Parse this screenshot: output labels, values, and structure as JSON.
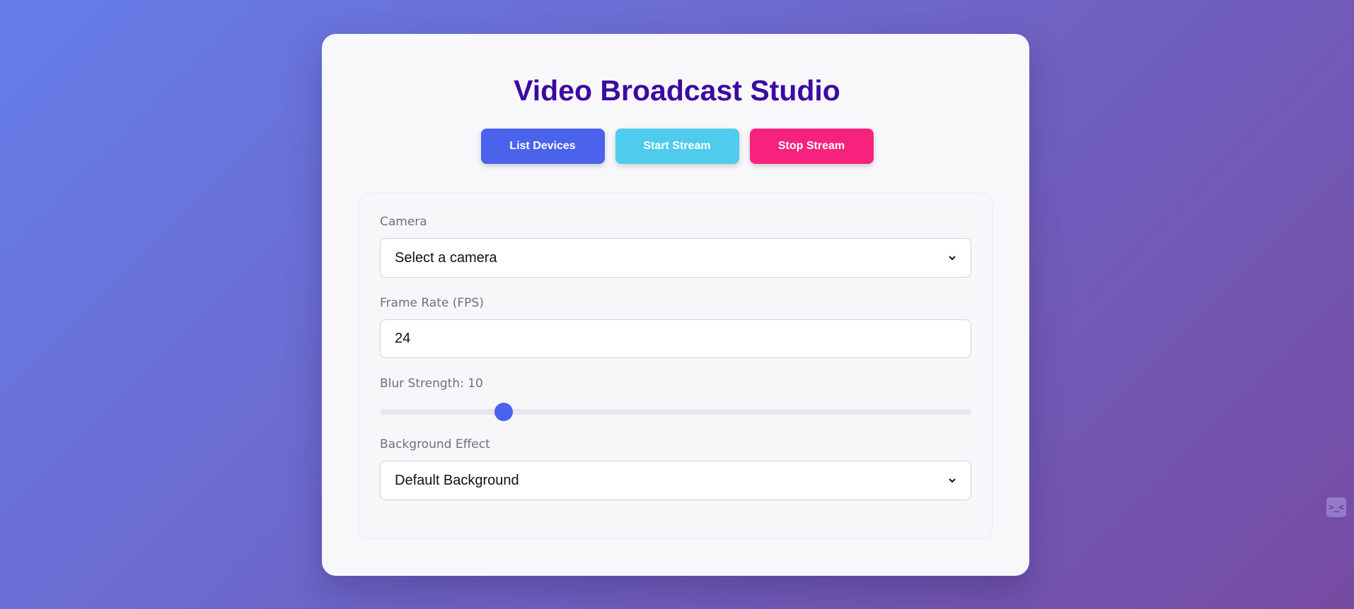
{
  "app": {
    "title": "Video Broadcast Studio"
  },
  "toolbar": {
    "list_label": "List Devices",
    "start_label": "Start Stream",
    "stop_label": "Stop Stream"
  },
  "form": {
    "camera": {
      "label": "Camera",
      "value": "Select a camera"
    },
    "fps": {
      "label": "Frame Rate (FPS)",
      "value": "24"
    },
    "blur": {
      "label": "Blur Strength: 10",
      "value": 10,
      "max": 50
    },
    "background": {
      "label": "Background Effect",
      "value": "Default Background"
    }
  },
  "helper": {
    "glyph": ">‿<"
  },
  "colors": {
    "title": "#3b0aa2",
    "list_button": "#4a62ec",
    "start_button": "#4ecbed",
    "stop_button": "#f7227d",
    "slider_thumb": "#4a62ec"
  }
}
